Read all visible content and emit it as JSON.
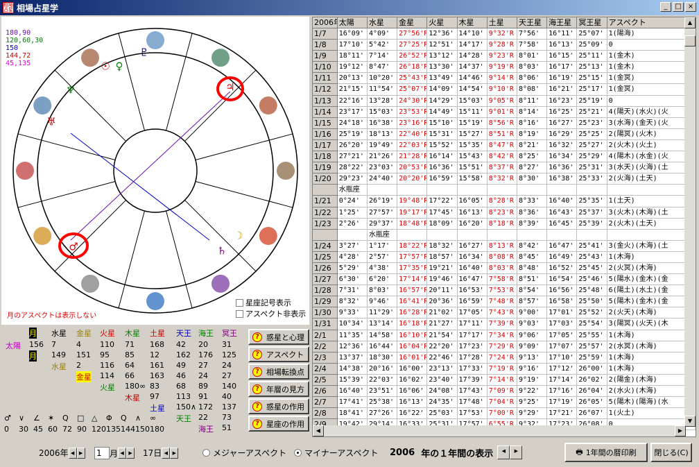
{
  "window": {
    "title": "相場占星学",
    "icon_text": "相場占星",
    "min": "_",
    "max": "□",
    "close": "×"
  },
  "chart": {
    "aspect_legend": [
      {
        "text": "180,90",
        "color": "#6a0dad"
      },
      {
        "text": "120,60,30",
        "color": "#008000"
      },
      {
        "text": "150",
        "color": "#0000c0"
      },
      {
        "text": "144,72",
        "color": "#c00000"
      },
      {
        "text": "45,135",
        "color": "#e000e0"
      }
    ],
    "moon_note": "月のアスペクトは表示しない",
    "cb_signs": "星座記号表示",
    "cb_aspect_hide": "アスペクト非表示",
    "planets": [
      {
        "glyph": "♇",
        "color": "#000080"
      },
      {
        "glyph": "☉",
        "color": "#c00000"
      },
      {
        "glyph": "♀",
        "color": "#008000"
      },
      {
        "glyph": "♆",
        "color": "#008000"
      },
      {
        "glyph": "♃",
        "color": "#e00000"
      },
      {
        "glyph": "♅",
        "color": "#c00000"
      },
      {
        "glyph": "♂",
        "color": "#e00000"
      },
      {
        "glyph": "☽",
        "color": "#c0a000"
      },
      {
        "glyph": "♄",
        "color": "#800080"
      }
    ]
  },
  "aspect_grid": {
    "cols": [
      "月",
      "水星",
      "金星",
      "火星",
      "木星",
      "土星",
      "天王",
      "海王",
      "冥王"
    ],
    "rows": [
      {
        "label": "太陽",
        "vals": [
          "156",
          "7",
          "4",
          "110",
          "71",
          "168",
          "42",
          "20",
          "31"
        ]
      },
      {
        "label": "月",
        "vals": [
          "149",
          "151",
          "95",
          "85",
          "12",
          "162",
          "176",
          "125"
        ]
      },
      {
        "label": "水星",
        "vals": [
          "2",
          "116",
          "64",
          "161",
          "49",
          "27",
          "24"
        ]
      },
      {
        "label": "金星",
        "vals": [
          "114",
          "66",
          "163",
          "46",
          "24",
          "27"
        ]
      },
      {
        "label": "火星",
        "vals": [
          "180∞",
          "83",
          "68",
          "89",
          "140"
        ]
      },
      {
        "label": "木星",
        "vals": [
          "97",
          "113",
          "91",
          "40"
        ]
      },
      {
        "label": "土星",
        "vals": [
          "150∧",
          "172",
          "137"
        ]
      },
      {
        "label": "天王",
        "vals": [
          "22",
          "73"
        ]
      },
      {
        "label": "海王",
        "vals": [
          "51"
        ]
      }
    ],
    "symbols": [
      "♂",
      "∨",
      "∠",
      "✶",
      "Q",
      "□",
      "△",
      "Φ",
      "Q",
      "∧",
      "∞"
    ],
    "degrees": [
      "0",
      "30",
      "45",
      "60",
      "72",
      "90",
      "120",
      "135",
      "144",
      "150",
      "180"
    ]
  },
  "side_buttons": [
    "惑星と心理",
    "アスペクト",
    "相場転換点",
    "年層の見方",
    "惑星の作用",
    "星座の作用"
  ],
  "ephemeris": {
    "headers": [
      "2006年",
      "太陽",
      "水星",
      "金星",
      "火星",
      "木星",
      "土星",
      "天王星",
      "海王星",
      "冥王星",
      "アスペクト"
    ],
    "rows": [
      [
        "1/7",
        "16°09'",
        "4°09'",
        "27°56'R",
        "12°36'",
        "14°10'",
        "9°32'R",
        "7°56'",
        "16°11'",
        "25°07'",
        "1(陽海)"
      ],
      [
        "1/8",
        "17°10'",
        "5°42'",
        "27°25'R",
        "12°51'",
        "14°17'",
        "9°28'R",
        "7°58'",
        "16°13'",
        "25°09'",
        "0"
      ],
      [
        "1/9",
        "18°11'",
        "7°14'",
        "26°52'R",
        "13°12'",
        "14°28'",
        "9°23'R",
        "8°01'",
        "16°15'",
        "25°11'",
        "1(金木)"
      ],
      [
        "1/10",
        "19°12'",
        "8°47'",
        "26°18'R",
        "13°30'",
        "14°37'",
        "9°19'R",
        "8°03'",
        "16°17'",
        "25°13'",
        "1(金木)"
      ],
      [
        "1/11",
        "20°13'",
        "10°20'",
        "25°43'R",
        "13°49'",
        "14°46'",
        "9°14'R",
        "8°06'",
        "16°19'",
        "25°15'",
        "1(金冥)"
      ],
      [
        "1/12",
        "21°15'",
        "11°54'",
        "25°07'R",
        "14°09'",
        "14°54'",
        "9°10'R",
        "8°08'",
        "16°21'",
        "25°17'",
        "1(金冥)"
      ],
      [
        "1/13",
        "22°16'",
        "13°28'",
        "24°30'R",
        "14°29'",
        "15°03'",
        "9°05'R",
        "8°11'",
        "16°23'",
        "25°19'",
        "0"
      ],
      [
        "1/14",
        "23°17'",
        "15°03'",
        "23°53'R",
        "14°49'",
        "15°11'",
        "9°01'R",
        "8°14'",
        "16°25'",
        "25°21'",
        "4(陽天)(水火)(火"
      ],
      [
        "1/15",
        "24°18'",
        "16°38'",
        "23°16'R",
        "15°10'",
        "15°19'",
        "8°56'R",
        "8°16'",
        "16°27'",
        "25°23'",
        "3(水海)(金天)(火"
      ],
      [
        "1/16",
        "25°19'",
        "18°13'",
        "22°40'R",
        "15°31'",
        "15°27'",
        "8°51'R",
        "8°19'",
        "16°29'",
        "25°25'",
        "2(陽冥)(火木)"
      ],
      [
        "1/17",
        "26°20'",
        "19°49'",
        "22°03'R",
        "15°52'",
        "15°35'",
        "8°47'R",
        "8°21'",
        "16°32'",
        "25°27'",
        "2(火木)(火土)"
      ],
      [
        "1/18",
        "27°21'",
        "21°26'",
        "21°28'R",
        "16°14'",
        "15°43'",
        "8°42'R",
        "8°25'",
        "16°34'",
        "25°29'",
        "4(陽木)(水金)(火"
      ],
      [
        "1/19",
        "28°22'",
        "23°03'",
        "20°53'R",
        "16°36'",
        "15°51'",
        "8°37'R",
        "8°27'",
        "16°36'",
        "25°31'",
        "3(水天)(火海)(土"
      ],
      [
        "1/20",
        "29°23'",
        "24°40'",
        "20°20'R",
        "16°59'",
        "15°58'",
        "8°32'R",
        "8°30'",
        "16°38'",
        "25°33'",
        "2(火海)(土天)"
      ],
      [
        "",
        "水瓶座",
        "",
        "",
        "",
        "",
        "",
        "",
        "",
        "",
        ""
      ],
      [
        "1/21",
        "0°24'",
        "26°19'",
        "19°48'R",
        "17°22'",
        "16°05'",
        "8°28'R",
        "8°33'",
        "16°40'",
        "25°35'",
        "1(土天)"
      ],
      [
        "1/22",
        "1°25'",
        "27°57'",
        "19°17'R",
        "17°45'",
        "16°13'",
        "8°23'R",
        "8°36'",
        "16°43'",
        "25°37'",
        "3(火木)(木海)(土"
      ],
      [
        "1/23",
        "2°26'",
        "29°37'",
        "18°48'R",
        "18°09'",
        "16°20'",
        "8°18'R",
        "8°39'",
        "16°45'",
        "25°39'",
        "2(火木)(土天)"
      ],
      [
        "",
        "",
        "水瓶座",
        "",
        "",
        "",
        "",
        "",
        "",
        "",
        ""
      ],
      [
        "1/24",
        "3°27'",
        "1°17'",
        "18°22'R",
        "18°32'",
        "16°27'",
        "8°13'R",
        "8°42'",
        "16°47'",
        "25°41'",
        "3(金火)(木海)(土"
      ],
      [
        "1/25",
        "4°28'",
        "2°57'",
        "17°57'R",
        "18°57'",
        "16°34'",
        "8°08'R",
        "8°45'",
        "16°49'",
        "25°43'",
        "1(木海)"
      ],
      [
        "1/26",
        "5°29'",
        "4°38'",
        "17°35'R",
        "19°21'",
        "16°40'",
        "8°03'R",
        "8°48'",
        "16°52'",
        "25°45'",
        "2(火冥)(木海)"
      ],
      [
        "1/27",
        "6°30'",
        "6°20'",
        "17°14'R",
        "19°46'",
        "16°47'",
        "7°58'R",
        "8°51'",
        "16°54'",
        "25°46'",
        "5(陽水)(金木)(金"
      ],
      [
        "1/28",
        "7°31'",
        "8°03'",
        "16°57'R",
        "20°11'",
        "16°53'",
        "7°53'R",
        "8°54'",
        "16°56'",
        "25°48'",
        "6(陽土)(水土)(金"
      ],
      [
        "1/29",
        "8°32'",
        "9°46'",
        "16°41'R",
        "20°36'",
        "16°59'",
        "7°48'R",
        "8°57'",
        "16°58'",
        "25°50'",
        "5(陽木)(金木)(金"
      ],
      [
        "1/30",
        "9°33'",
        "11°29'",
        "16°28'R",
        "21°02'",
        "17°05'",
        "7°43'R",
        "9°00'",
        "17°01'",
        "25°52'",
        "2(火天)(木海)"
      ],
      [
        "1/31",
        "10°34'",
        "13°14'",
        "16°18'R",
        "21°27'",
        "17°11'",
        "7°39'R",
        "9°03'",
        "17°03'",
        "25°54'",
        "3(陽冥)(火天)(木"
      ],
      [
        "2/1",
        "11°35'",
        "14°58'",
        "16°10'R",
        "21°54'",
        "17°17'",
        "7°34'R",
        "9°06'",
        "17°05'",
        "25°55'",
        "1(木海)"
      ],
      [
        "2/2",
        "12°36'",
        "16°44'",
        "16°04'R",
        "22°20'",
        "17°23'",
        "7°29'R",
        "9°09'",
        "17°07'",
        "25°57'",
        "2(水冥)(木海)"
      ],
      [
        "2/3",
        "13°37'",
        "18°30'",
        "16°01'R",
        "22°46'",
        "17°28'",
        "7°24'R",
        "9°13'",
        "17°10'",
        "25°59'",
        "1(木海)"
      ],
      [
        "2/4",
        "14°38'",
        "20°16'",
        "16°00'",
        "23°13'",
        "17°33'",
        "7°19'R",
        "9°16'",
        "17°12'",
        "26°00'",
        "1(木海)"
      ],
      [
        "2/5",
        "15°39'",
        "22°03'",
        "16°02'",
        "23°40'",
        "17°39'",
        "7°14'R",
        "9°19'",
        "17°14'",
        "26°02'",
        "2(陽金)(木海)"
      ],
      [
        "2/6",
        "16°40'",
        "23°51'",
        "16°06'",
        "24°08'",
        "17°43'",
        "7°09'R",
        "9°22'",
        "17°16'",
        "26°04'",
        "2(水火)(木海)"
      ],
      [
        "2/7",
        "17°41'",
        "25°38'",
        "16°13'",
        "24°35'",
        "17°48'",
        "7°04'R",
        "9°25'",
        "17°19'",
        "26°05'",
        "5(陽木)(陽海)(水"
      ],
      [
        "2/8",
        "18°41'",
        "27°26'",
        "16°22'",
        "25°03'",
        "17°53'",
        "7°00'R",
        "9°29'",
        "17°21'",
        "26°07'",
        "1(火土)"
      ],
      [
        "2/9",
        "19°42'",
        "29°14'",
        "16°33'",
        "25°31'",
        "17°57'",
        "6°55'R",
        "9°32'",
        "17°23'",
        "26°08'",
        "0"
      ]
    ]
  },
  "bottom": {
    "year": "2006",
    "year_unit": "年",
    "month": "1",
    "month_unit": "月",
    "day": "17",
    "day_unit": "日",
    "major": "メジャーアスペクト",
    "minor": "マイナーアスペクト",
    "display_year": "2006",
    "display_text": "年の１年間の表示",
    "print": "1年間の暦印刷",
    "close": "閉じる(C)"
  }
}
